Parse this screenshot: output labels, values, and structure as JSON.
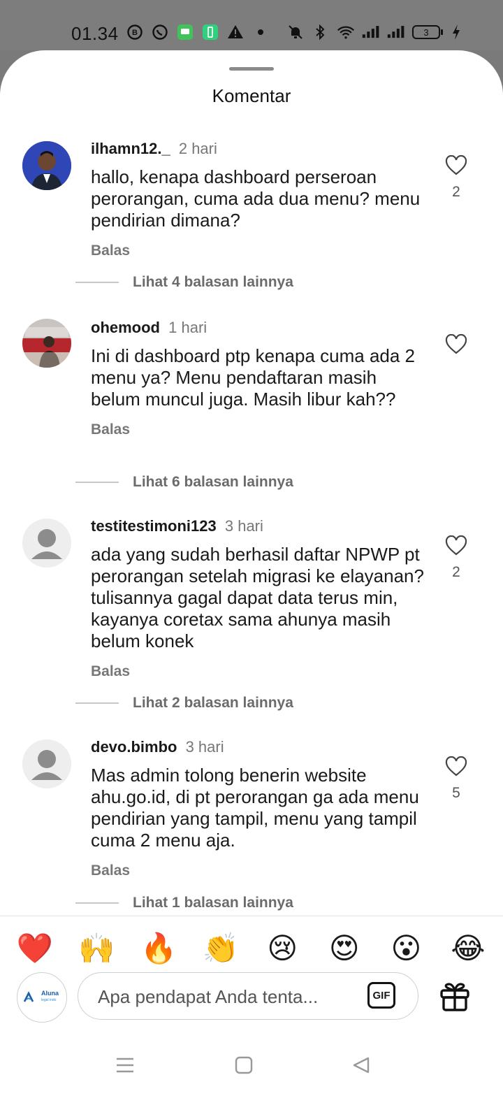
{
  "status_bar": {
    "time": "01.34",
    "battery": "3",
    "left_icons": [
      "whatsapp-business-icon",
      "whatsapp-icon",
      "messages-icon",
      "battery-saver-icon",
      "alert-icon",
      "dot-icon"
    ],
    "right_icons": [
      "mute-icon",
      "bluetooth-icon",
      "wifi-icon",
      "signal-icon",
      "signal-icon",
      "battery-icon",
      "charging-icon"
    ]
  },
  "sheet": {
    "title": "Komentar"
  },
  "comments": [
    {
      "username": "ilhamn12._",
      "time": "2 hari",
      "text": "hallo, kenapa dashboard perseroan perorangan, cuma ada dua menu? menu pendirian dimana?",
      "reply": "Balas",
      "likes": "2",
      "view_replies": "Lihat 4 balasan lainnya"
    },
    {
      "username": "ohemood",
      "time": "1 hari",
      "text": "Ini di dashboard ptp kenapa cuma ada 2 menu ya? Menu pendaftaran masih belum muncul juga. Masih libur kah??",
      "reply": "Balas",
      "likes": "",
      "view_replies": "Lihat 6 balasan lainnya"
    },
    {
      "username": "testitestimoni123",
      "time": "3 hari",
      "text": "ada yang sudah berhasil daftar NPWP pt perorangan setelah migrasi ke elayanan? tulisannya gagal dapat data terus min, kayanya coretax sama ahunya masih belum konek",
      "reply": "Balas",
      "likes": "2",
      "view_replies": "Lihat 2 balasan lainnya"
    },
    {
      "username": "devo.bimbo",
      "time": "3 hari",
      "text": "Mas admin tolong benerin website ahu.go.id, di pt perorangan ga ada menu pendirian yang tampil, menu yang tampil cuma 2 menu aja.",
      "reply": "Balas",
      "likes": "5",
      "view_replies": "Lihat 1 balasan lainnya"
    }
  ],
  "reactions": [
    "❤️",
    "🙌",
    "🔥",
    "👏",
    "😢",
    "😍",
    "😮",
    "😂"
  ],
  "composer": {
    "account_logo_text": "Aluna",
    "account_logo_sub": "legal indo",
    "placeholder": "Apa pendapat Anda tenta...",
    "gif_label": "GIF"
  },
  "colors": {
    "accent_logo": "#1b5fa8",
    "text_muted": "#777777"
  }
}
